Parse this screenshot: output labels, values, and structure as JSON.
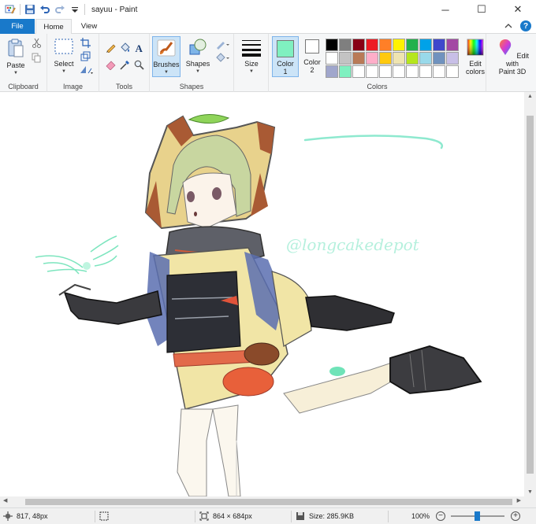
{
  "window": {
    "title": "sayuu - Paint",
    "controls": {
      "minimize": "─",
      "maximize": "☐",
      "close": "✕"
    }
  },
  "tabs": [
    {
      "label": "File"
    },
    {
      "label": "Home"
    },
    {
      "label": "View"
    }
  ],
  "help": {
    "label": "?"
  },
  "ribbon": {
    "clipboard": {
      "label": "Clipboard",
      "paste": "Paste"
    },
    "image": {
      "label": "Image",
      "select": "Select"
    },
    "tools": {
      "label": "Tools"
    },
    "shapes": {
      "label": "Shapes",
      "brushes": "Brushes",
      "shapes_btn": "Shapes"
    },
    "size": {
      "label": "Size"
    },
    "colors": {
      "label": "Colors",
      "color1_line1": "Color",
      "color1_line2": "1",
      "color2_line1": "Color",
      "color2_line2": "2",
      "edit_line1": "Edit",
      "edit_line2": "colors",
      "paint3d_line1": "Edit with",
      "paint3d_line2": "Paint 3D",
      "color1_value": "#7ff0c0",
      "color2_value": "#ffffff",
      "palette": [
        "#000000",
        "#7f7f7f",
        "#880015",
        "#ed1c24",
        "#ff7f27",
        "#fff200",
        "#22b14c",
        "#00a2e8",
        "#3f48cc",
        "#a349a4",
        "#ffffff",
        "#c3c3c3",
        "#b97a57",
        "#ffaec9",
        "#ffc90e",
        "#efe4b0",
        "#b5e61d",
        "#99d9ea",
        "#7092be",
        "#c8bfe7",
        "#a0a6cc",
        "#7ff0c0",
        "#ffffff",
        "#ffffff",
        "#ffffff",
        "#ffffff",
        "#ffffff",
        "#ffffff",
        "#ffffff",
        "#ffffff"
      ]
    }
  },
  "canvas": {
    "watermark": "@longcakedepot"
  },
  "status": {
    "cursor": "817, 48px",
    "image_size": "864 × 684px",
    "file_size": "Size: 285.9KB",
    "zoom": "100%",
    "zoom_level": 100
  }
}
